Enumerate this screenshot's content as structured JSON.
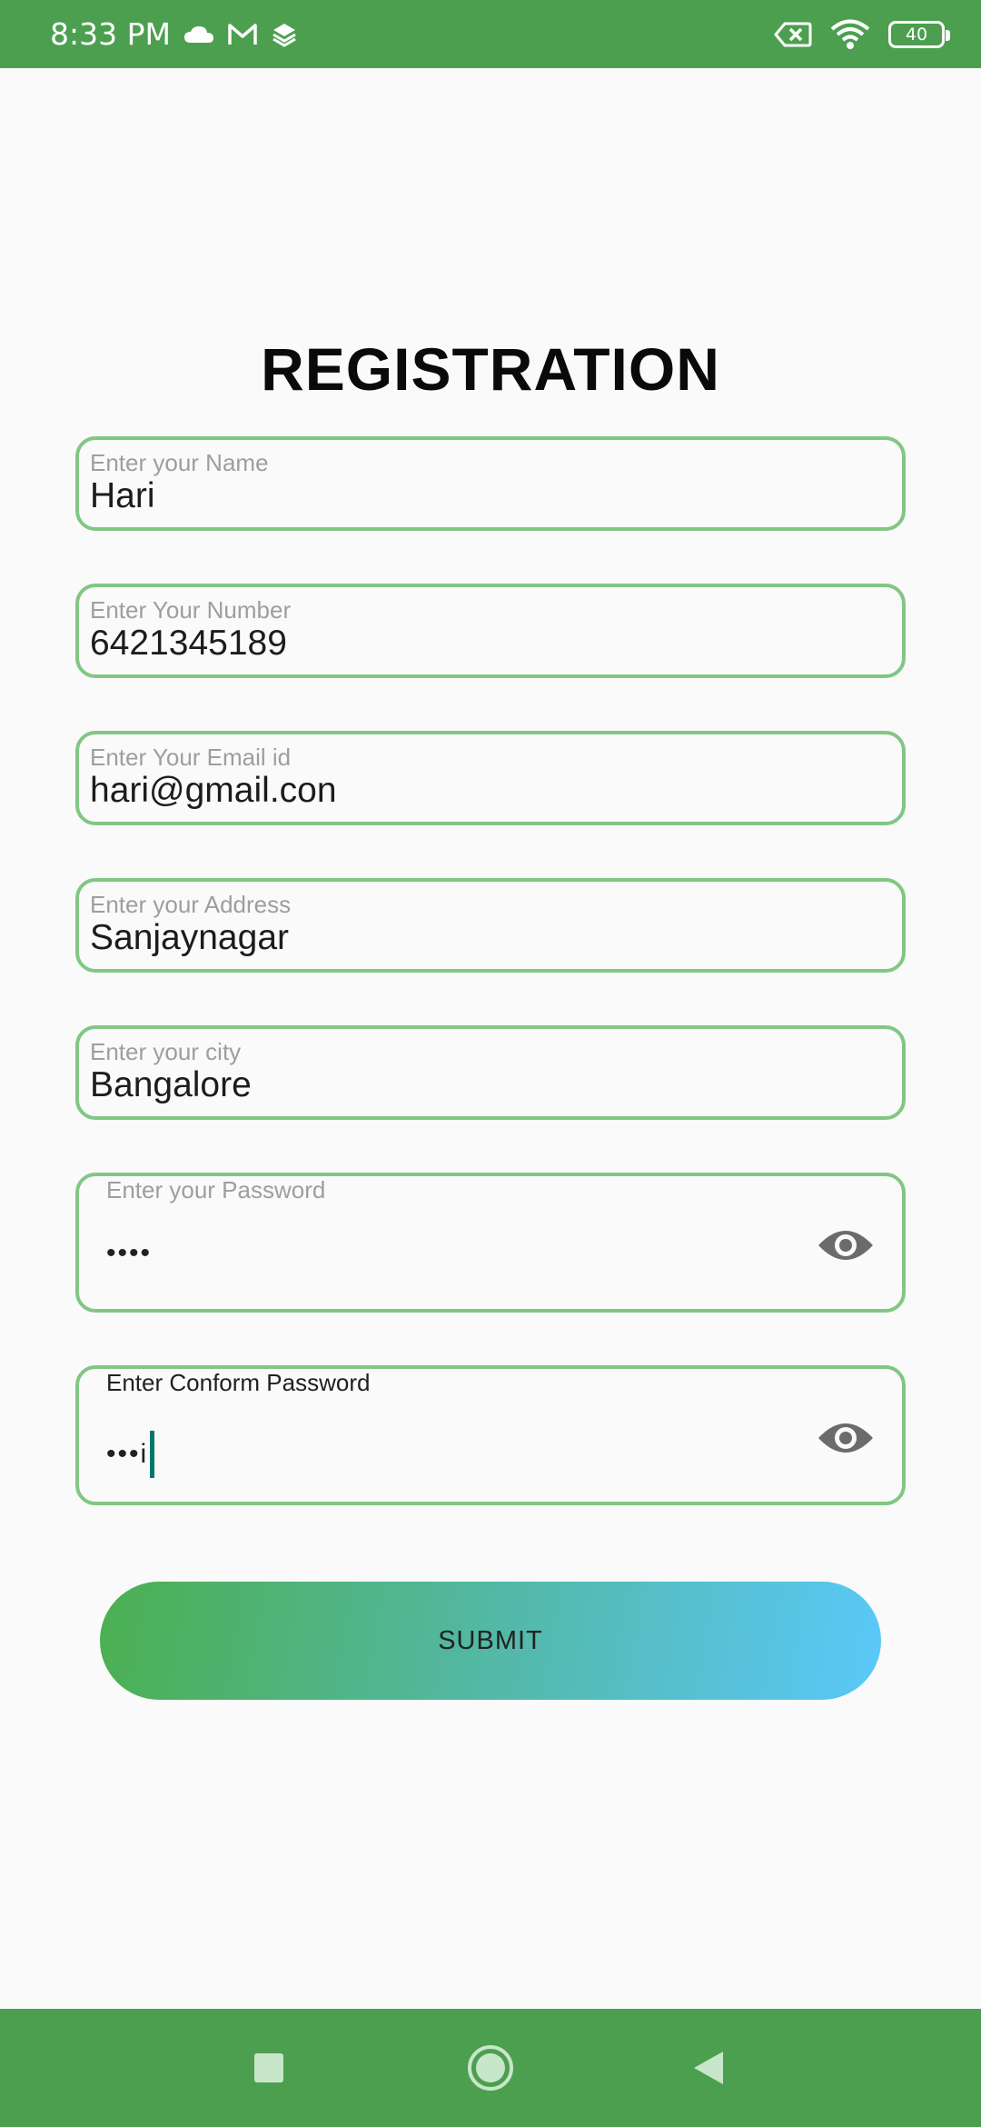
{
  "status_bar": {
    "time": "8:33 PM",
    "icons_left": [
      "cloud-icon",
      "gmail-icon",
      "layers-icon"
    ],
    "icons_right": [
      "data-saver-icon",
      "wifi-icon",
      "battery-icon"
    ],
    "battery": "40"
  },
  "page": {
    "title": "REGISTRATION"
  },
  "form": {
    "name": {
      "hint": "Enter your Name",
      "value": "Hari"
    },
    "number": {
      "hint": "Enter Your Number",
      "value": "6421345189"
    },
    "email": {
      "hint": "Enter Your Email id",
      "value": "hari@gmail.con"
    },
    "address": {
      "hint": "Enter your Address",
      "value": "Sanjaynagar"
    },
    "city": {
      "hint": "Enter your city",
      "value": "Bangalore"
    },
    "password": {
      "hint": "Enter your Password",
      "value": "••••"
    },
    "confirm_password": {
      "hint": "Enter Conform Password",
      "value": "•••i"
    }
  },
  "submit": {
    "label": "SUBMIT"
  },
  "colors": {
    "status_bar": "#4c9f4f",
    "field_border": "#81c784",
    "gradient_start": "#4caf50",
    "gradient_end": "#5ac8fa",
    "cursor": "#00796b"
  },
  "nav": {
    "icons": [
      "recent-apps-icon",
      "home-icon",
      "back-icon"
    ]
  }
}
